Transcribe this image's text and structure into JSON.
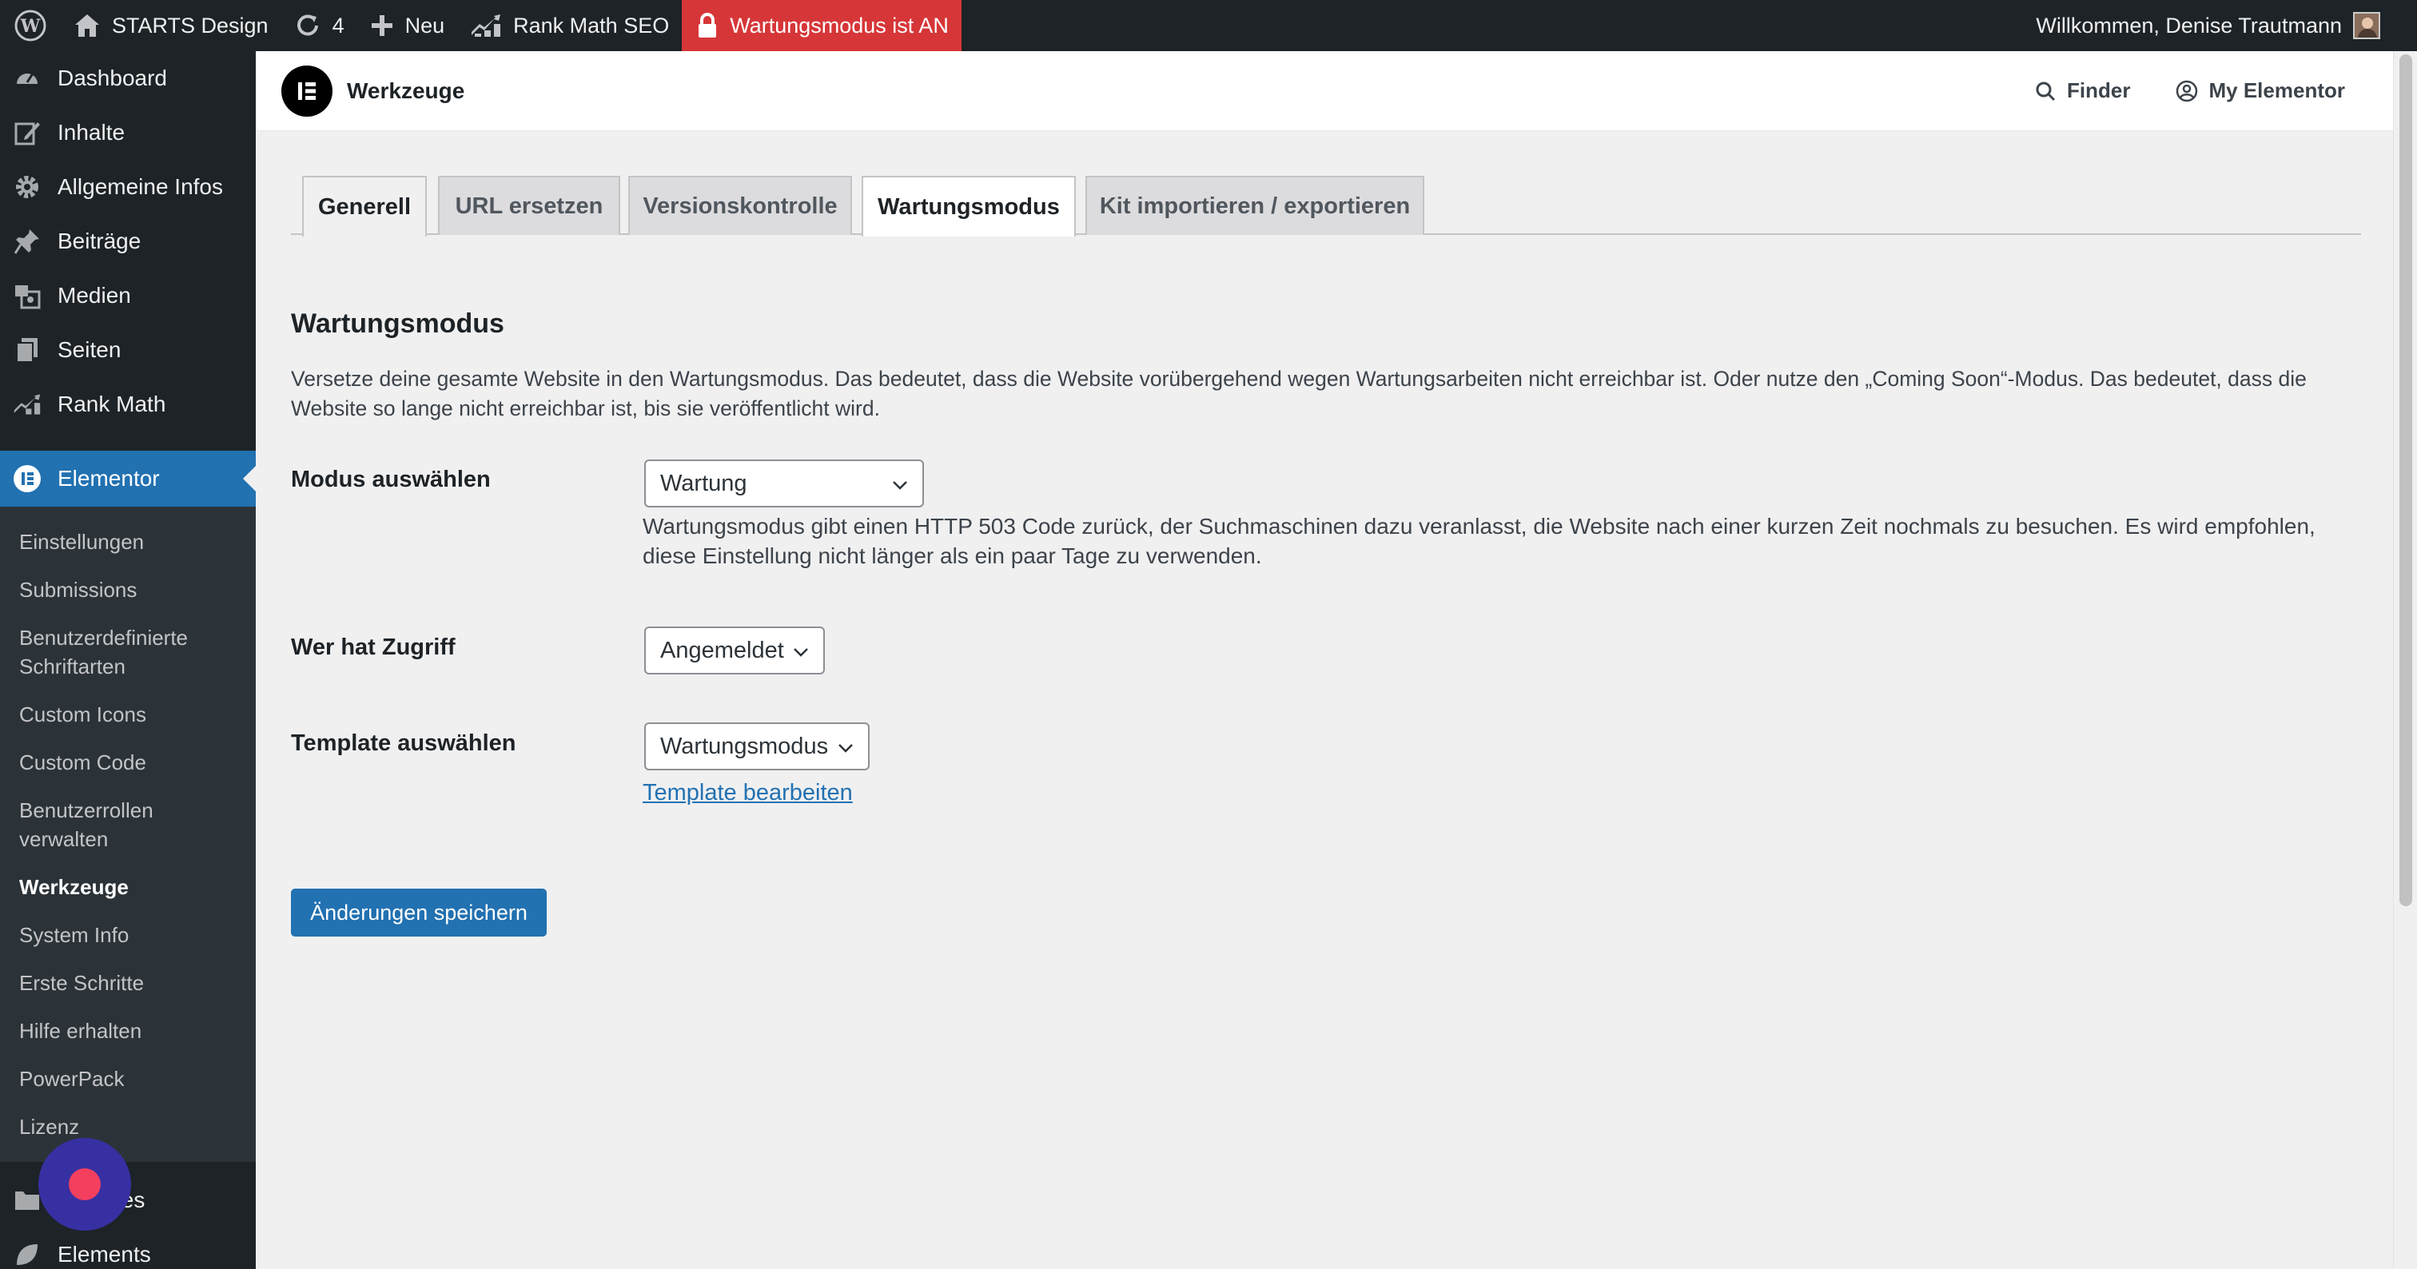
{
  "adminbar": {
    "site_name": "STARTS Design",
    "updates_count": "4",
    "new_label": "Neu",
    "seo_label": "Rank Math SEO",
    "maintenance_label": "Wartungsmodus ist AN",
    "welcome": "Willkommen, Denise Trautmann"
  },
  "sidebar": {
    "items": [
      {
        "label": "Dashboard",
        "icon": "dashboard-icon"
      },
      {
        "label": "Inhalte",
        "icon": "edit-icon"
      },
      {
        "label": "Allgemeine Infos",
        "icon": "gear-icon"
      },
      {
        "label": "Beiträge",
        "icon": "pin-icon"
      },
      {
        "label": "Medien",
        "icon": "media-icon"
      },
      {
        "label": "Seiten",
        "icon": "pages-icon"
      },
      {
        "label": "Rank Math",
        "icon": "rankmath-icon"
      }
    ],
    "current": {
      "label": "Elementor",
      "icon": "elementor-icon"
    },
    "submenu": [
      "Einstellungen",
      "Submissions",
      "Benutzerdefinierte Schriftarten",
      "Custom Icons",
      "Custom Code",
      "Benutzerrollen verwalten",
      "Werkzeuge",
      "System Info",
      "Erste Schritte",
      "Hilfe erhalten",
      "PowerPack",
      "Lizenz"
    ],
    "after": [
      {
        "label": "Templates",
        "icon": "folder-icon"
      },
      {
        "label": "Elements",
        "icon": "leaf-icon"
      }
    ],
    "templates_visible": "tes"
  },
  "topbar": {
    "title": "Werkzeuge",
    "finder": "Finder",
    "my_elementor": "My Elementor"
  },
  "tabs": [
    "Generell",
    "URL ersetzen",
    "Versionskontrolle",
    "Wartungsmodus",
    "Kit importieren / exportieren"
  ],
  "section": {
    "title": "Wartungsmodus",
    "description": "Versetze deine gesamte Website in den Wartungsmodus. Das bedeutet, dass die Website vorübergehend wegen Wartungsarbeiten nicht erreichbar ist. Oder nutze den „Coming Soon“-Modus. Das bedeutet, dass die Website so lange nicht erreichbar ist, bis sie veröffentlicht wird."
  },
  "fields": {
    "mode_label": "Modus auswählen",
    "mode_value": "Wartung",
    "mode_desc": "Wartungsmodus gibt einen HTTP 503 Code zurück, der Suchmaschinen dazu veranlasst, die Website nach einer kurzen Zeit nochmals zu besuchen. Es wird empfohlen, diese Einstellung nicht länger als ein paar Tage zu verwenden.",
    "access_label": "Wer hat Zugriff",
    "access_value": "Angemeldet",
    "template_label": "Template auswählen",
    "template_value": "Wartungsmodus",
    "template_edit": "Template bearbeiten"
  },
  "save_label": "Änderungen speichern",
  "colors": {
    "admin_bg": "#1d2327",
    "accent": "#2271b1",
    "maintenance": "#d63638",
    "fab": "#3730a3",
    "fab_dot": "#f43f5e"
  }
}
